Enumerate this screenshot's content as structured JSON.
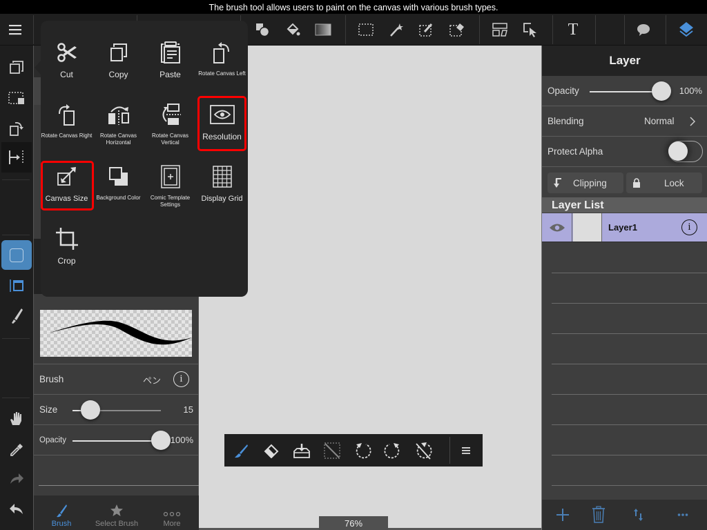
{
  "caption": "The brush tool allows users to paint on the canvas with various brush types.",
  "toolbar": {
    "menu_icon": "hamburger-icon",
    "tools": [
      {
        "name": "shape-tool",
        "icon": "shapes-icon"
      },
      {
        "name": "fill-tool",
        "icon": "paint-bucket-icon"
      },
      {
        "name": "gradient-tool",
        "icon": "gradient-icon"
      },
      {
        "name": "select-rect-tool",
        "icon": "marquee-icon"
      },
      {
        "name": "magic-wand-tool",
        "icon": "magic-wand-icon"
      },
      {
        "name": "select-pen-tool",
        "icon": "selection-pen-icon"
      },
      {
        "name": "select-eraser-tool",
        "icon": "selection-eraser-icon"
      },
      {
        "name": "frame-divider-tool",
        "icon": "panel-layout-icon"
      },
      {
        "name": "operation-tool",
        "icon": "select-cursor-icon"
      },
      {
        "name": "text-tool",
        "icon": "text-icon",
        "label": "T"
      },
      {
        "name": "speech-bubble-tool",
        "icon": "speech-bubble-icon"
      },
      {
        "name": "layers-button",
        "icon": "layers-icon"
      }
    ]
  },
  "popup_menu": {
    "items": [
      {
        "label": "Cut",
        "icon": "scissors-icon",
        "highlighted": false
      },
      {
        "label": "Copy",
        "icon": "copy-icon",
        "highlighted": false
      },
      {
        "label": "Paste",
        "icon": "paste-icon",
        "highlighted": false
      },
      {
        "label": "Rotate Canvas Left",
        "icon": "rotate-left-icon",
        "highlighted": false
      },
      {
        "label": "Rotate Canvas Right",
        "icon": "rotate-right-icon",
        "highlighted": false
      },
      {
        "label": "Rotate Canvas Horizontal",
        "icon": "flip-horizontal-icon",
        "highlighted": false
      },
      {
        "label": "Rotate Canvas Vertical",
        "icon": "flip-vertical-icon",
        "highlighted": false
      },
      {
        "label": "Resolution",
        "icon": "resolution-icon",
        "highlighted": true
      },
      {
        "label": "Canvas Size",
        "icon": "canvas-size-icon",
        "highlighted": true
      },
      {
        "label": "Background Color",
        "icon": "background-color-icon",
        "highlighted": false
      },
      {
        "label": "Comic Template Settings",
        "icon": "comic-template-icon",
        "highlighted": false
      },
      {
        "label": "Display Grid",
        "icon": "grid-icon",
        "highlighted": false
      },
      {
        "label": "Crop",
        "icon": "crop-icon",
        "highlighted": false
      }
    ],
    "highlight_color": "#ff0000"
  },
  "left_toolbar": {
    "tools": [
      "copy-layer-icon",
      "selection-transform-icon",
      "rotate-icon",
      "flip-guide-icon",
      "color-swatch-icon",
      "window-icon",
      "brush-icon",
      "hand-icon",
      "eyedropper-icon",
      "redo-icon",
      "undo-icon"
    ],
    "accent": "#4a87bd"
  },
  "brush_panel": {
    "brush_label": "Brush",
    "brush_name": "ペン",
    "size_label": "Size",
    "size_value": "15",
    "size_fraction": 0.2,
    "opacity_label": "Opacity",
    "opacity_value": "100%",
    "opacity_fraction": 1.0,
    "tabs": [
      {
        "label": "Brush",
        "icon": "brush-icon",
        "active": true
      },
      {
        "label": "Select Brush",
        "icon": "star-icon",
        "active": false
      },
      {
        "label": "More",
        "icon": "more-icon",
        "active": false
      }
    ]
  },
  "canvas": {
    "zoom": "76%",
    "background": "#d9d9d9"
  },
  "float_toolbar": {
    "tools": [
      "brush-icon",
      "eraser-icon",
      "import-icon",
      "deselect-icon",
      "undo-icon",
      "redo-icon",
      "clear-icon",
      "menu-icon"
    ]
  },
  "layer_panel": {
    "title": "Layer",
    "opacity_label": "Opacity",
    "opacity_value": "100%",
    "opacity_fraction": 1.0,
    "blending_label": "Blending",
    "blending_value": "Normal",
    "protect_alpha_label": "Protect Alpha",
    "protect_alpha_on": false,
    "clipping_label": "Clipping",
    "lock_label": "Lock",
    "list_title": "Layer List",
    "layers": [
      {
        "name": "Layer1",
        "visible": true,
        "selected": true
      }
    ],
    "selected_color": "#acaadc",
    "footer": [
      "add-layer-icon",
      "trash-icon",
      "reorder-icon",
      "more-icon"
    ]
  }
}
